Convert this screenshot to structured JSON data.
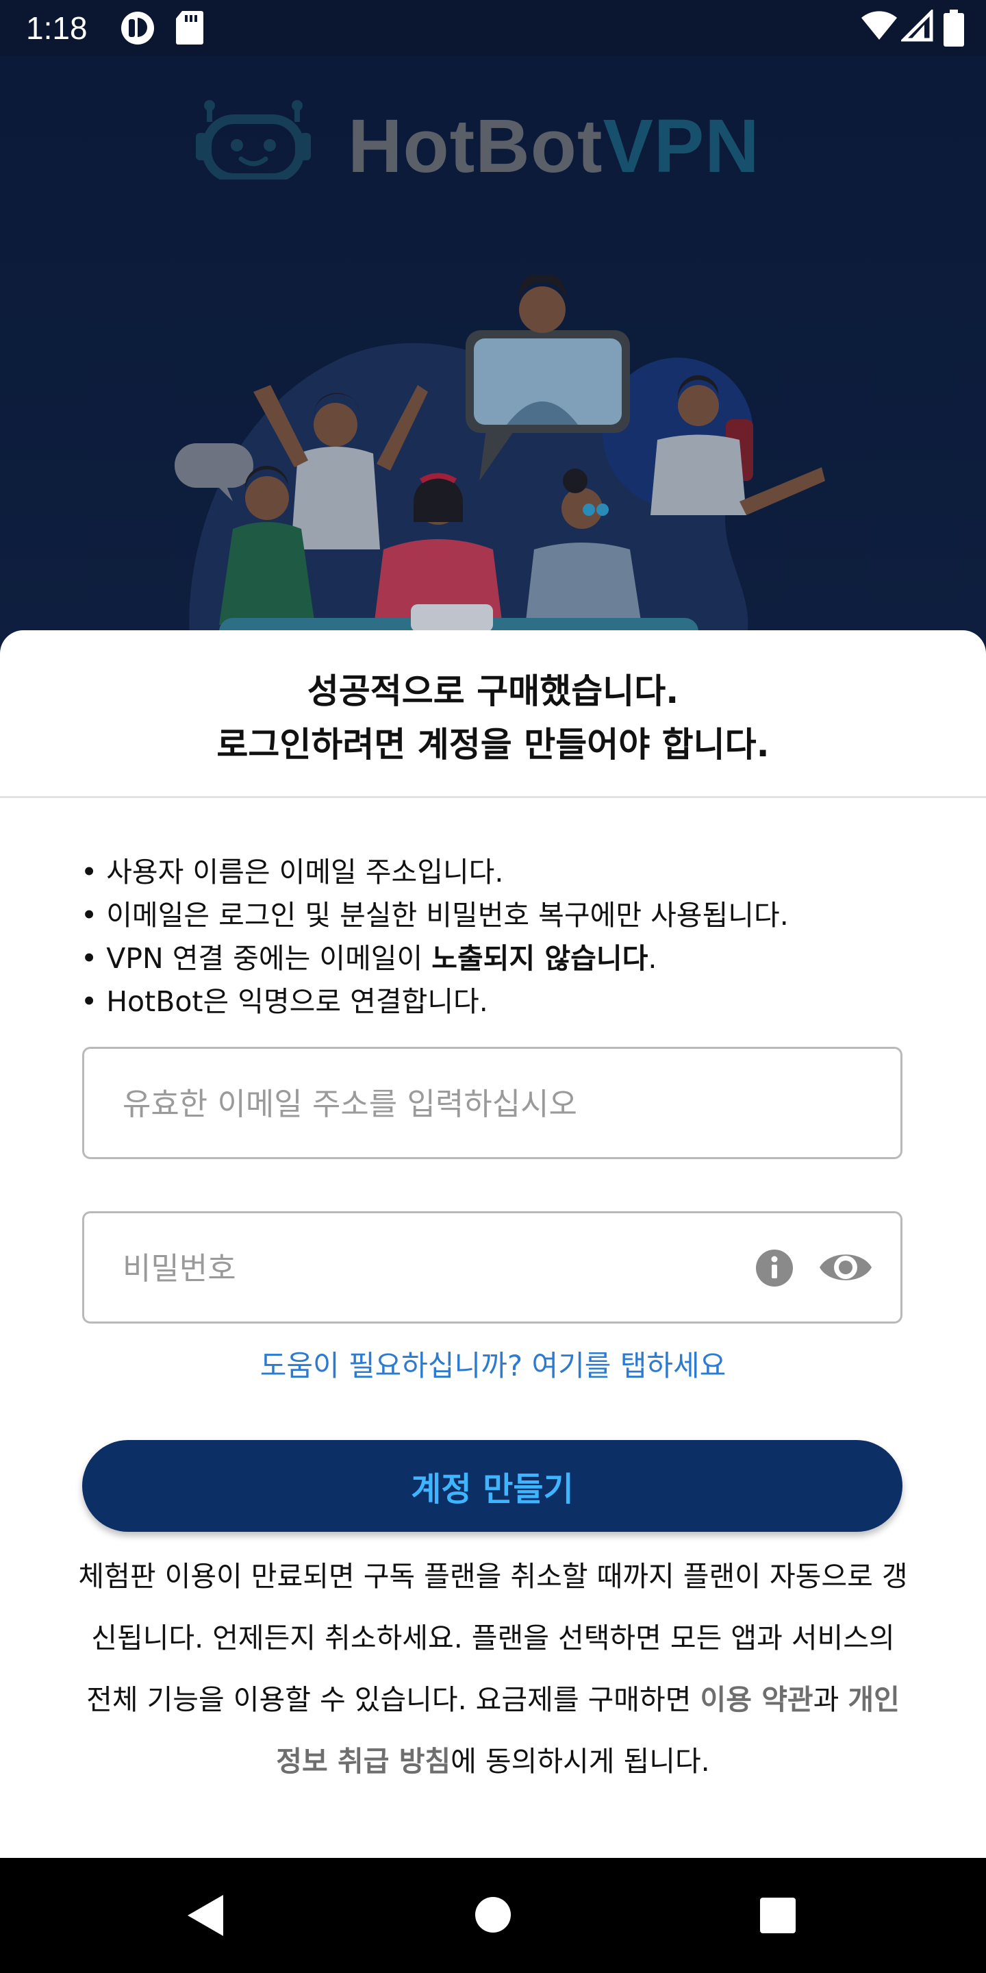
{
  "status_bar": {
    "time": "1:18",
    "icons": [
      "hotspot-app-icon",
      "sd-card-icon",
      "wifi-icon",
      "signal-icon",
      "battery-icon"
    ]
  },
  "hero": {
    "logo_part1": "HotBot",
    "logo_part2": "VPN"
  },
  "sheet": {
    "title_line1": "성공적으로 구매했습니다.",
    "title_line2": "로그인하려면 계정을 만들어야 합니다.",
    "bullets": {
      "b1": "• 사용자 이름은 이메일 주소입니다.",
      "b2": "• 이메일은 로그인 및 분실한 비밀번호 복구에만 사용됩니다.",
      "b3_pre": "• VPN 연결 중에는 이메일이 ",
      "b3_bold": "노출되지 않습니다",
      "b3_post": ".",
      "b4": "• HotBot은 익명으로 연결합니다."
    },
    "email_placeholder": "유효한 이메일 주소를 입력하십시오",
    "email_value": "",
    "password_placeholder": "비밀번호",
    "password_value": "",
    "help_link": "도움이 필요하십니까? 여기를 탭하세요",
    "create_button": "계정 만들기",
    "terms": {
      "text1": "체험판 이용이 만료되면 구독 플랜을 취소할 때까지 플랜이 자동으로 갱신됩니다. 언제든지 취소하세요. 플랜을 선택하면 모든 앱과 서비스의 전체 기능을 이용할 수 있습니다. 요금제를 구매하면 ",
      "link1": "이용 약관",
      "text2": "과 ",
      "link2": "개인 정보 취급 방침",
      "text3": "에 동의하시게 됩니다."
    }
  },
  "nav": {
    "buttons": [
      "back-icon",
      "home-icon",
      "recents-icon"
    ]
  },
  "colors": {
    "hero_bg": "#0d1a33",
    "button_bg": "#0c2f66",
    "button_text": "#3fb4ff",
    "link": "#2c7bd0"
  }
}
